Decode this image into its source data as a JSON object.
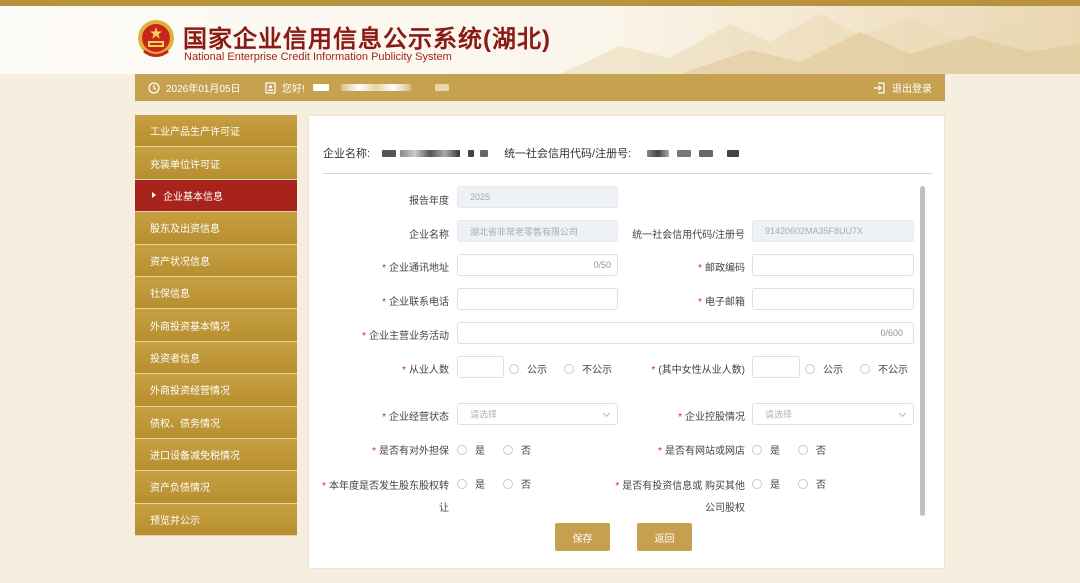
{
  "header": {
    "title_cn": "国家企业信用信息公示系统(湖北)",
    "title_en": "National Enterprise Credit Information Publicity System",
    "emblem_icon": "national-emblem-icon"
  },
  "infobar": {
    "date": "2026年01月05日",
    "greeting": "您好!",
    "logout": "退出登录"
  },
  "sidebar": {
    "items": [
      {
        "label": "工业产品生产许可证",
        "active": false
      },
      {
        "label": "充装单位许可证",
        "active": false
      },
      {
        "label": "企业基本信息",
        "active": true
      },
      {
        "label": "股东及出资信息",
        "active": false
      },
      {
        "label": "资产状况信息",
        "active": false
      },
      {
        "label": "社保信息",
        "active": false
      },
      {
        "label": "外商投资基本情况",
        "active": false
      },
      {
        "label": "投资者信息",
        "active": false
      },
      {
        "label": "外商投资经营情况",
        "active": false
      },
      {
        "label": "债权、债务情况",
        "active": false
      },
      {
        "label": "进口设备减免税情况",
        "active": false
      },
      {
        "label": "资产负债情况",
        "active": false
      },
      {
        "label": "预览并公示",
        "active": false
      }
    ]
  },
  "main": {
    "company_name_label": "企业名称:",
    "credit_code_label": "统一社会信用代码/注册号:",
    "form": {
      "report_year": {
        "label": "报告年度",
        "value": "2025"
      },
      "company_name": {
        "label": "企业名称",
        "value": "湖北省非常老零售有限公司"
      },
      "credit_code": {
        "label": "统一社会信用代码/注册号",
        "value": "91420602MA35F8UU7X"
      },
      "address": {
        "label": "企业通讯地址",
        "counter": "0/50"
      },
      "postcode": {
        "label": "邮政编码"
      },
      "phone": {
        "label": "企业联系电话"
      },
      "email": {
        "label": "电子邮箱"
      },
      "business": {
        "label": "企业主营业务活动",
        "counter": "0/600"
      },
      "employees": {
        "label": "从业人数",
        "opt_public": "公示",
        "opt_private": "不公示"
      },
      "female_employees": {
        "label": "(其中女性从业人数)",
        "opt_public": "公示",
        "opt_private": "不公示"
      },
      "status": {
        "label": "企业经营状态",
        "placeholder": "请选择"
      },
      "holding": {
        "label": "企业控股情况",
        "placeholder": "请选择"
      },
      "guarantee": {
        "label": "是否有对外担保",
        "yes": "是",
        "no": "否"
      },
      "website": {
        "label": "是否有网站或网店",
        "yes": "是",
        "no": "否"
      },
      "equity_transfer": {
        "label_line1": "本年度是否发生股东股权转",
        "label_line2": "让",
        "yes": "是",
        "no": "否"
      },
      "investment": {
        "label_line1": "是否有投资信息或 购买其他",
        "label_line2": "公司股权",
        "yes": "是",
        "no": "否"
      }
    },
    "buttons": {
      "save": "保存",
      "back": "返回"
    }
  },
  "colors": {
    "gold": "#c6a14f",
    "active_red": "#a8231c",
    "title_red": "#8a1a14",
    "required_red": "#d9271f"
  }
}
